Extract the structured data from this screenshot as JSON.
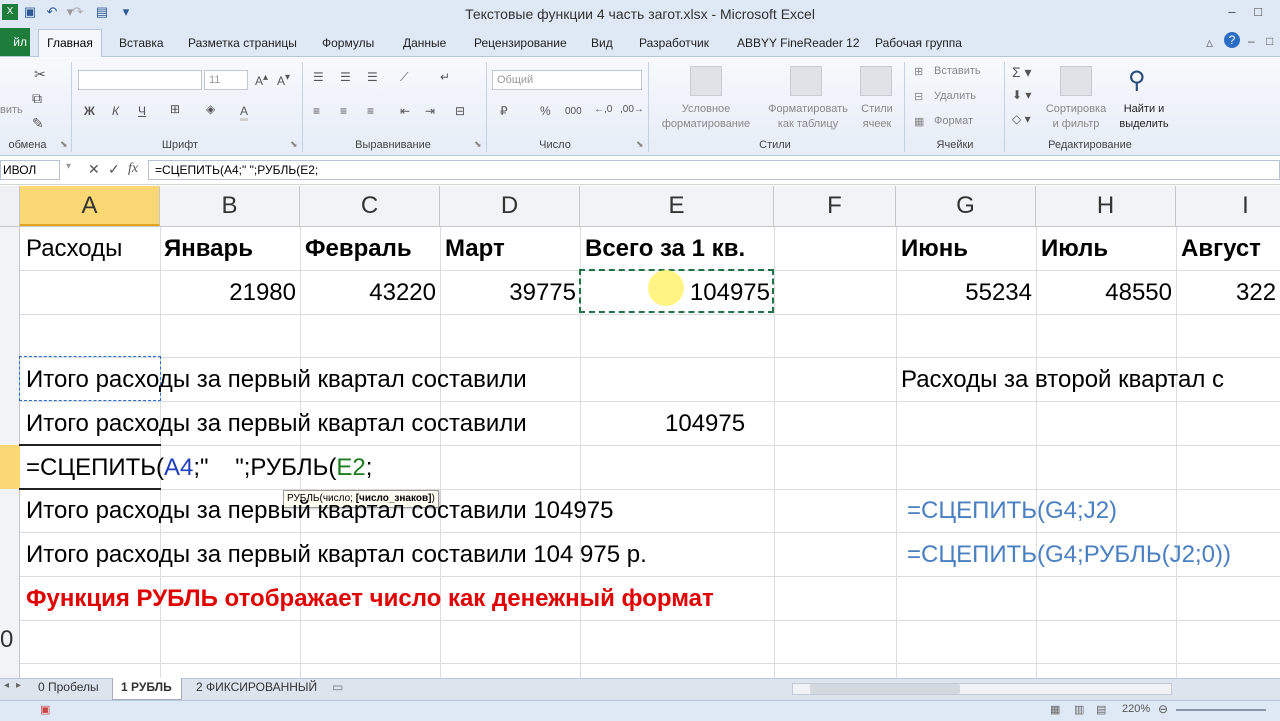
{
  "window": {
    "title": "Текстовые функции 4 часть загот.xlsx  -  Microsoft Excel"
  },
  "ribbon_tabs": [
    "Главная",
    "Вставка",
    "Разметка страницы",
    "Формулы",
    "Данные",
    "Рецензирование",
    "Вид",
    "Разработчик",
    "ABBYY FineReader 12",
    "Рабочая группа"
  ],
  "file_tab": "йл",
  "ribbon": {
    "clipboard_label": "обмена",
    "clipboard_cut_label": "вить",
    "font_label": "Шрифт",
    "font_size": "11",
    "alignment_label": "Выравнивание",
    "number_label": "Число",
    "number_format": "Общий",
    "number_pct": "%",
    "number_thousands": "000",
    "styles_label": "Стили",
    "cond_format": [
      "Условное",
      "форматирование"
    ],
    "format_table": [
      "Форматировать",
      "как таблицу"
    ],
    "cell_styles": [
      "Стили",
      "ячеек"
    ],
    "cells_label": "Ячейки",
    "insert": "Вставить",
    "delete": "Удалить",
    "format": "Формат",
    "editing_label": "Редактирование",
    "sort_filter": [
      "Сортировка",
      "и фильтр"
    ],
    "find_select": [
      "Найти и",
      "выделить"
    ]
  },
  "formula_bar": {
    "name_box": "ИВОЛ",
    "formula": "=СЦЕПИТЬ(A4;\"    \";РУБЛЬ(E2;"
  },
  "columns": [
    "A",
    "B",
    "C",
    "D",
    "E",
    "F",
    "G",
    "H",
    "I"
  ],
  "row_numbers": [
    "0"
  ],
  "cells": {
    "a1": "Расходы",
    "b1": "Январь",
    "c1": "Февраль",
    "d1": "Март",
    "e1": "Всего за 1 кв.",
    "g1": "Июнь",
    "h1": "Июль",
    "i1": "Август",
    "b2": "21980",
    "c2": "43220",
    "d2": "39775",
    "e2": "104975",
    "g2": "55234",
    "h2": "48550",
    "i2": "322",
    "a4": "Итого расходы за первый квартал составили",
    "g4": "Расходы за второй квартал с",
    "a5": "Итого расходы за первый квартал составили",
    "e5": "104975",
    "a6_prefix": "=СЦЕПИТЬ(",
    "a6_ref1": "A4",
    "a6_mid": ";\"    \";РУБЛЬ(",
    "a6_ref2": "E2",
    "a6_tail": ";",
    "a7": "Итого расходы за первый квартал составили 104975",
    "g7": "=СЦЕПИТЬ(G4;J2)",
    "a8": "Итого расходы за первый квартал составили 104 975 р.",
    "g8": "=СЦЕПИТЬ(G4;РУБЛЬ(J2;0))",
    "a9": "Функция РУБЛЬ отображает число как денежный формат"
  },
  "tooltip": {
    "func": "РУБЛЬ(число; ",
    "arg": "[число_знаков]",
    "close": ")"
  },
  "sheet_tabs": [
    "0 Пробелы",
    "1 РУБЛЬ",
    "2 ФИКСИРОВАННЫЙ"
  ],
  "active_sheet": "1 РУБЛЬ",
  "zoom": "220%",
  "colors": {
    "accent_green": "#217346",
    "ref_blue": "#1f3fbf",
    "ref_green": "#1e7d1e",
    "red": "#e00000",
    "formula_blue": "#4a7fc1"
  }
}
